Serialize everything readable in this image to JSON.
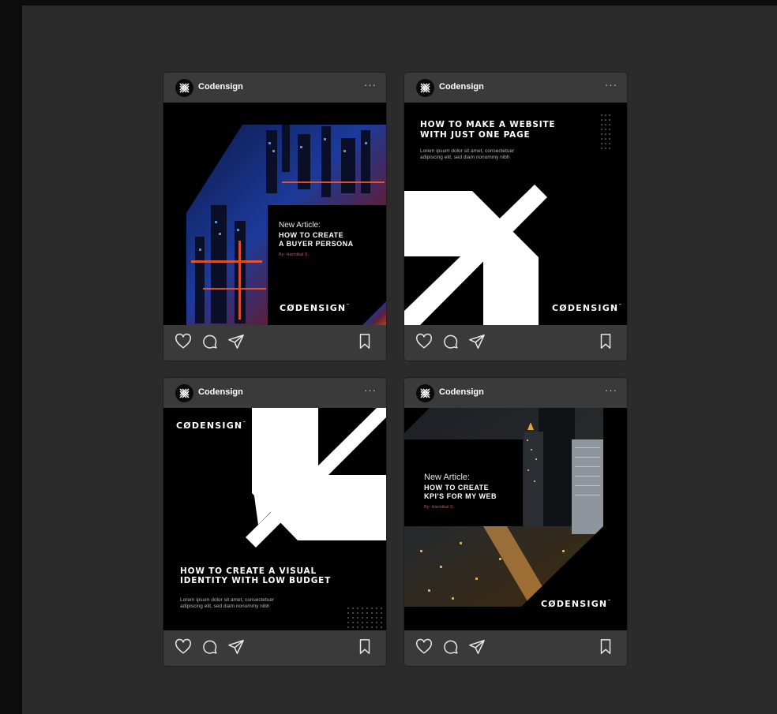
{
  "account": {
    "name": "Codensign",
    "more": "···"
  },
  "brand": {
    "wordmark": "CØDENSIGN",
    "tm": "™"
  },
  "posts": [
    {
      "kind": "article",
      "label": "New Article:",
      "title_line1": "HOW TO CREATE",
      "title_line2": "A BUYER PERSONA",
      "author": "By: Hannibal S."
    },
    {
      "kind": "headline",
      "headline_line1": "HOW TO MAKE A WEBSITE",
      "headline_line2": "WITH JUST ONE PAGE",
      "body_line1": "Lorem ipsum dolor sit amet, consectetuer",
      "body_line2": "adipiscing elit, sed diam nonummy nibh"
    },
    {
      "kind": "headline",
      "headline_line1": "HOW TO CREATE A VISUAL",
      "headline_line2": "IDENTITY WITH LOW BUDGET",
      "body_line1": "Lorem ipsum dolor sit amet, consectetuer",
      "body_line2": "adipiscing elit, sed diam nonummy nibh"
    },
    {
      "kind": "article",
      "label": "New Article:",
      "title_line1": "HOW TO CREATE",
      "title_line2": "KPI'S FOR MY WEB",
      "author": "By: Hannibal S."
    }
  ],
  "icons": {
    "like": "heart-icon",
    "comment": "comment-icon",
    "share": "send-icon",
    "save": "bookmark-icon",
    "more": "more-dots-icon",
    "avatar": "codensign-logo-icon"
  },
  "colors": {
    "canvas": "#2b2b2b",
    "card": "#3a3a3a",
    "post": "#000000",
    "accent": "#e2454b",
    "text": "#ffffff"
  }
}
